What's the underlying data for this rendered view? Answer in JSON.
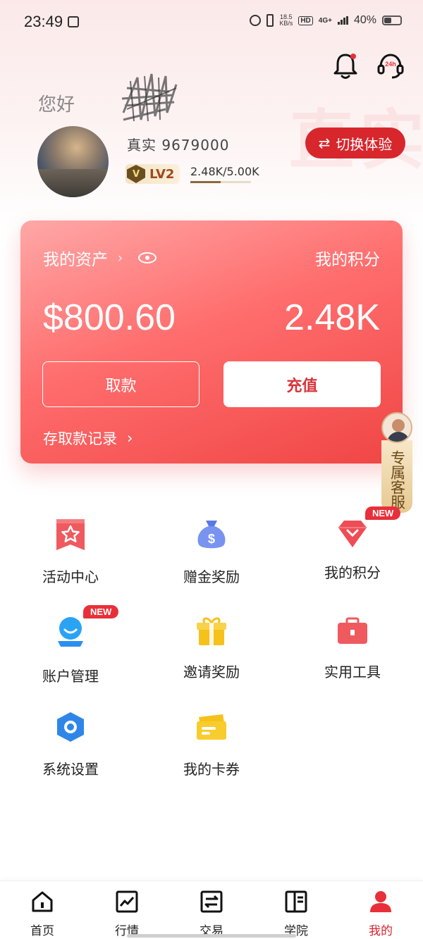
{
  "status_bar": {
    "time": "23:49",
    "net_speed_value": "18.5",
    "net_speed_unit": "KB/s",
    "hd": "HD",
    "network": "4G+",
    "battery": "40%"
  },
  "profile": {
    "greeting": "您好",
    "account_label": "真实 9679000",
    "level": "LV2",
    "level_progress_text": "2.48K/5.00K",
    "level_progress": 0.496,
    "switch_button": "切换体验",
    "switch_icon": "swap-arrows-icon"
  },
  "asset_card": {
    "title": "我的资产",
    "chevron": "›",
    "points_label": "我的积分",
    "balance": "$800.60",
    "points": "2.48K",
    "withdraw_label": "取款",
    "deposit_label": "充值",
    "records_label": "存取款记录",
    "records_chevron": "›"
  },
  "float_support": {
    "label": "专属客服"
  },
  "menu": [
    {
      "label": "活动中心",
      "icon": "star-flag-icon",
      "badge": ""
    },
    {
      "label": "赠金奖励",
      "icon": "money-bag-icon",
      "badge": ""
    },
    {
      "label": "我的积分",
      "icon": "diamond-icon",
      "badge": "NEW"
    },
    {
      "label": "账户管理",
      "icon": "user-account-icon",
      "badge": "NEW"
    },
    {
      "label": "邀请奖励",
      "icon": "gift-icon",
      "badge": ""
    },
    {
      "label": "实用工具",
      "icon": "toolbox-icon",
      "badge": ""
    },
    {
      "label": "系统设置",
      "icon": "settings-hex-icon",
      "badge": ""
    },
    {
      "label": "我的卡券",
      "icon": "coupon-icon",
      "badge": ""
    }
  ],
  "bottom_nav": [
    {
      "label": "首页",
      "icon": "home-icon",
      "active": false
    },
    {
      "label": "行情",
      "icon": "chart-icon",
      "active": false
    },
    {
      "label": "交易",
      "icon": "exchange-icon",
      "active": false
    },
    {
      "label": "学院",
      "icon": "book-icon",
      "active": false
    },
    {
      "label": "我的",
      "icon": "profile-icon",
      "active": true
    }
  ],
  "colors": {
    "brand_red": "#d8262d",
    "card_gradient_start": "#ffa7a7",
    "card_gradient_end": "#f04545",
    "new_badge": "#e8303a"
  }
}
